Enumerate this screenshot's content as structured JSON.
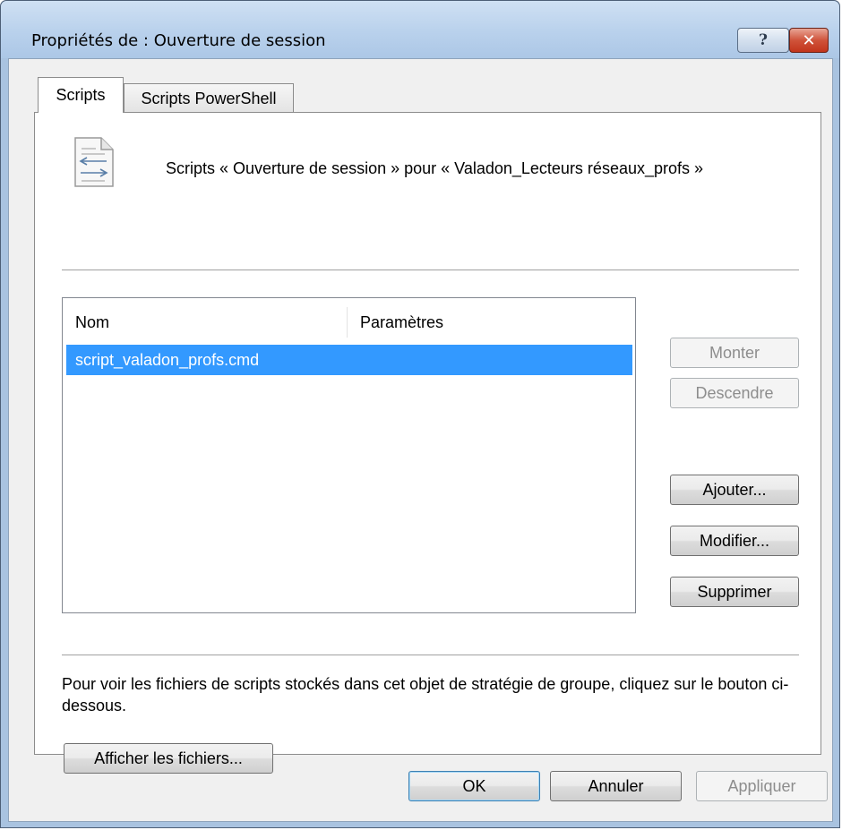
{
  "window": {
    "title": "Propriétés de : Ouverture de session",
    "help_glyph": "?",
    "close_glyph": "✕"
  },
  "tabs": [
    {
      "label": "Scripts",
      "active": true
    },
    {
      "label": "Scripts PowerShell",
      "active": false
    }
  ],
  "header": {
    "icon": "script-file-icon",
    "text": "Scripts « Ouverture de session » pour « Valadon_Lecteurs réseaux_profs »"
  },
  "list": {
    "columns": [
      "Nom",
      "Paramètres"
    ],
    "rows": [
      {
        "name": "script_valadon_profs.cmd",
        "params": "",
        "selected": true
      }
    ]
  },
  "side_buttons": {
    "up": "Monter",
    "down": "Descendre",
    "add": "Ajouter...",
    "edit": "Modifier...",
    "remove": "Supprimer"
  },
  "info": {
    "text": "Pour voir les fichiers de scripts stockés dans cet objet de stratégie de groupe, cliquez sur le bouton ci-dessous.",
    "show_files": "Afficher les fichiers..."
  },
  "footer": {
    "ok": "OK",
    "cancel": "Annuler",
    "apply": "Appliquer"
  },
  "colors": {
    "selection": "#3399ff",
    "titlebar": "#b9d1ec",
    "close": "#c7432b"
  }
}
